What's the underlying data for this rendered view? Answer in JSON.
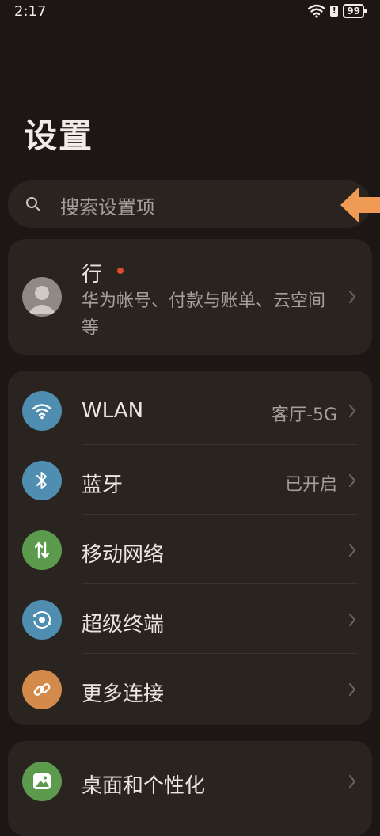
{
  "status": {
    "time": "2:17",
    "battery": "99"
  },
  "title": "设置",
  "search": {
    "placeholder": "搜索设置项"
  },
  "account": {
    "name": "行",
    "desc": "华为帐号、付款与账单、云空间等"
  },
  "connect_items": [
    {
      "label": "WLAN",
      "value": "客厅-5G",
      "icon": "wifi-icon",
      "color": "#4f8eb1"
    },
    {
      "label": "蓝牙",
      "value": "已开启",
      "icon": "bluetooth-icon",
      "color": "#4f8eb1"
    },
    {
      "label": "移动网络",
      "value": "",
      "icon": "mobile-data-icon",
      "color": "#5c9a4e"
    },
    {
      "label": "超级终端",
      "value": "",
      "icon": "super-device-icon",
      "color": "#4f8eb1"
    },
    {
      "label": "更多连接",
      "value": "",
      "icon": "link-icon",
      "color": "#d48a4a"
    }
  ],
  "display_items": [
    {
      "label": "桌面和个性化",
      "icon": "wallpaper-icon",
      "color": "#5c9a4e"
    }
  ],
  "colors": {
    "background": "#1c1714",
    "card": "#2a2420",
    "accent_arrow": "#ef9a55",
    "red_dot": "#e04a2e"
  }
}
